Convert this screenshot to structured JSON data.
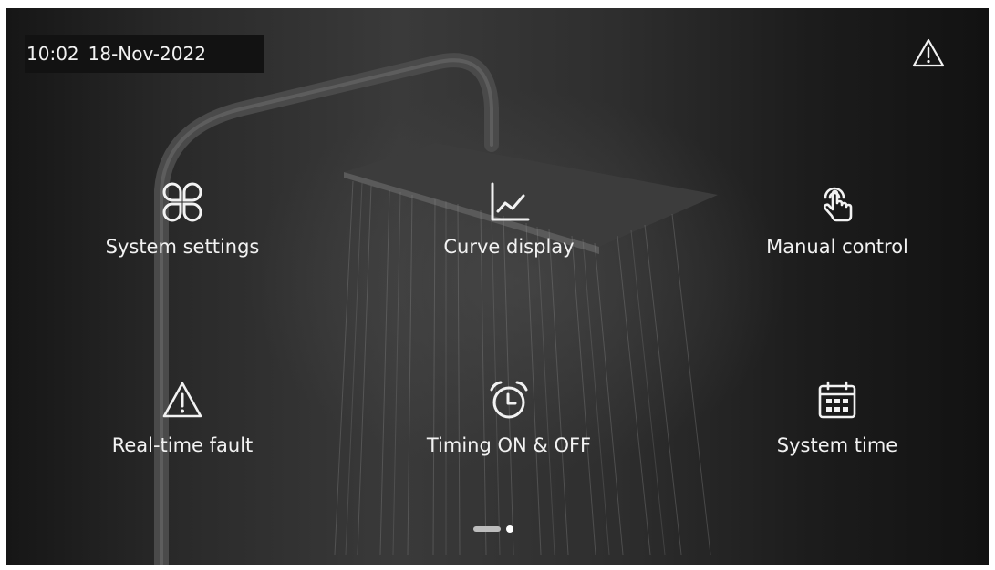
{
  "status_bar": {
    "time": "10:02",
    "date": "18-Nov-2022",
    "alert_icon": "warning-triangle-icon"
  },
  "menu": [
    {
      "label": "System settings",
      "icon": "four-leaf-grid-icon"
    },
    {
      "label": "Curve display",
      "icon": "line-chart-icon"
    },
    {
      "label": "Manual control",
      "icon": "touch-hand-icon"
    },
    {
      "label": "Real-time fault",
      "icon": "warning-triangle-icon"
    },
    {
      "label": "Timing ON & OFF",
      "icon": "alarm-clock-icon"
    },
    {
      "label": "System time",
      "icon": "calendar-icon"
    }
  ],
  "pagination": {
    "current_page": 1,
    "total_pages": 2
  },
  "colors": {
    "foreground": "#f2f2f2",
    "background": "#262626",
    "clock_bg": "#121212"
  }
}
